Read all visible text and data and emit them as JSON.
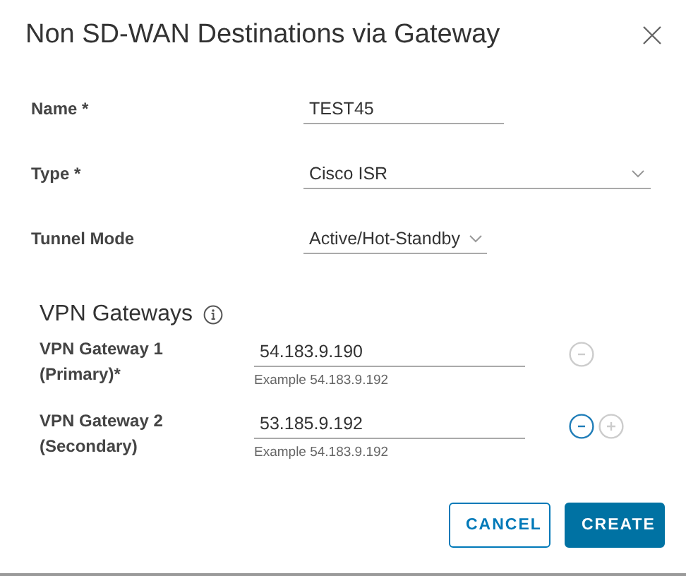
{
  "dialog": {
    "title": "Non SD-WAN Destinations via Gateway"
  },
  "fields": [
    {
      "kind": "text",
      "label": "Name *",
      "value": "TEST45"
    },
    {
      "kind": "select",
      "label": "Type *",
      "value": "Cisco ISR"
    },
    {
      "kind": "select",
      "label": "Tunnel Mode",
      "value": "Active/Hot-Standby"
    }
  ],
  "vpn_gateways": {
    "heading": "VPN Gateways",
    "items": [
      {
        "label": "VPN Gateway 1",
        "sublabel": "(Primary)*",
        "value": "54.183.9.190",
        "hint": "Example 54.183.9.192",
        "remove_disabled": true
      },
      {
        "label": "VPN Gateway 2",
        "sublabel": "(Secondary)",
        "value": "53.185.9.192",
        "hint": "Example 54.183.9.192",
        "remove_disabled": false,
        "add_disabled": true
      }
    ]
  },
  "buttons": [
    {
      "label": "CANCEL",
      "kind": "outline"
    },
    {
      "label": "CREATE",
      "kind": "primary"
    }
  ]
}
